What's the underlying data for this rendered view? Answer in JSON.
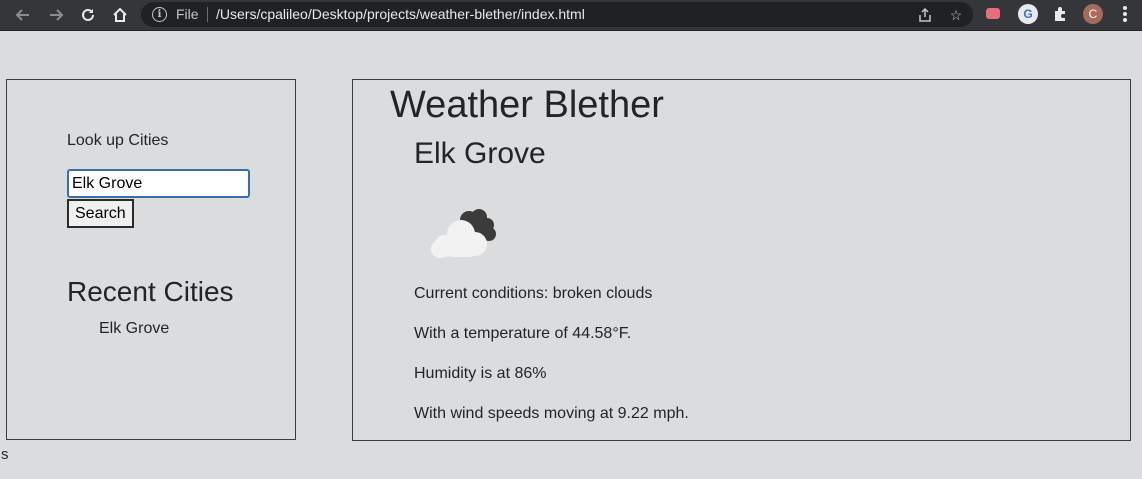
{
  "browser": {
    "scheme_label": "File",
    "url": "/Users/cpalileo/Desktop/projects/weather-blether/index.html",
    "profile_initial": "C",
    "extension_letter": "G"
  },
  "sidebar": {
    "search_heading": "Look up Cities",
    "search_value": "Elk Grove",
    "search_button": "Search",
    "recent_heading": "Recent Cities",
    "recent_cities": [
      "Elk Grove"
    ]
  },
  "main": {
    "title": "Weather Blether",
    "city": "Elk Grove",
    "weather_icon": "broken-clouds-icon",
    "conditions": "Current conditions: broken clouds",
    "temperature": "With a temperature of 44.58°F.",
    "humidity": "Humidity is at 86%",
    "wind": "With wind speeds moving at 9.22 mph."
  },
  "footer": {
    "stray_text": "s"
  }
}
